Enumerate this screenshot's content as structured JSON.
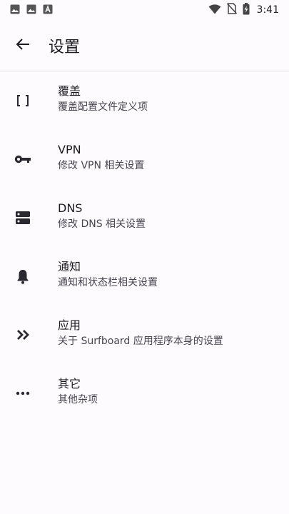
{
  "status_bar": {
    "time": "3:41",
    "icons": [
      "image-icon",
      "image-icon",
      "text-icon",
      "wifi-icon",
      "no-sim-icon",
      "battery-charging-icon"
    ]
  },
  "app_bar": {
    "title": "设置",
    "back_icon": "arrow-back-icon"
  },
  "settings": [
    {
      "title": "覆盖",
      "subtitle": "覆盖配置文件定义项",
      "icon": "brackets-icon"
    },
    {
      "title": "VPN",
      "subtitle": "修改 VPN 相关设置",
      "icon": "key-icon"
    },
    {
      "title": "DNS",
      "subtitle": "修改 DNS 相关设置",
      "icon": "dns-icon"
    },
    {
      "title": "通知",
      "subtitle": "通知和状态栏相关设置",
      "icon": "bell-icon"
    },
    {
      "title": "应用",
      "subtitle": "关于 Surfboard 应用程序本身的设置",
      "icon": "double-chevron-icon"
    },
    {
      "title": "其它",
      "subtitle": "其他杂项",
      "icon": "more-dots-icon"
    }
  ],
  "colors": {
    "background": "#fdfbfe",
    "text": "#1c1b1f",
    "subtext": "#49454f",
    "icon": "#2b2930"
  }
}
